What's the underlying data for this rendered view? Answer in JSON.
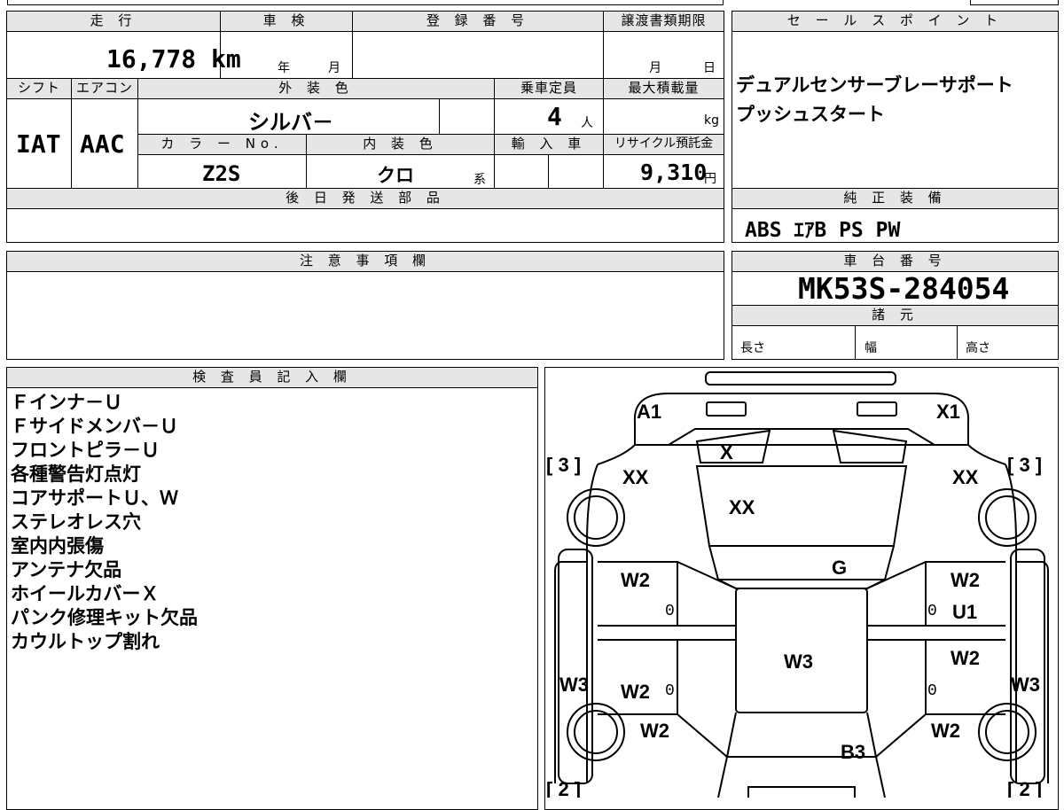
{
  "header": {
    "mileage_label": "走 行",
    "mileage_value": "16,778 km",
    "shaken_label": "車 検",
    "shaken_year_label": "年",
    "shaken_month_label": "月",
    "registration_label": "登 録 番 号",
    "transfer_label": "譲渡書類期限",
    "transfer_month_label": "月",
    "transfer_day_label": "日",
    "shift_label": "シフト",
    "shift_value": "IAT",
    "ac_label": "エアコン",
    "ac_value": "AAC",
    "exterior_color_label": "外 装 色",
    "exterior_color_value": "シルバ－",
    "capacity_label": "乗車定員",
    "capacity_value": "4",
    "capacity_unit": "人",
    "max_load_label": "最大積載量",
    "max_load_unit": "kg",
    "color_no_label": "カ ラ ー No.",
    "color_no_value": "Z2S",
    "interior_color_label": "内 装 色",
    "interior_color_value": "クロ",
    "interior_suffix": "系",
    "import_label": "輸 入 車",
    "recycle_label": "リサイクル預託金",
    "recycle_value": "9,310",
    "recycle_unit": "円",
    "later_parts_label": "後 日 発 送 部 品"
  },
  "sales_point": {
    "label": "セ ー ル ス ポ イ ン ト",
    "lines": [
      "デュアルセンサーブレーサポート",
      "プッシュスタート"
    ]
  },
  "equipment": {
    "label": "純 正 装 備",
    "value": "ABS ｴｱB PS PW"
  },
  "notes": {
    "label": "注 意 事 項 欄"
  },
  "chassis": {
    "label": "車 台 番 号",
    "value": "MK53S-284054",
    "spec_label": "諸 元",
    "length_label": "長さ",
    "width_label": "幅",
    "height_label": "高さ"
  },
  "inspector": {
    "label": "検 査 員 記 入 欄",
    "lines": [
      "Ｆインナ－Ｕ",
      "Ｆサイドメンバ－Ｕ",
      "フロントピラ－Ｕ",
      "各種警告灯点灯",
      "コアサポートＵ、Ｗ",
      "ステレオレス穴",
      "室内内張傷",
      "アンテナ欠品",
      "ホイールカバーＸ",
      "パンク修理キット欠品",
      "カウルトップ割れ"
    ]
  },
  "diagram": {
    "marks": {
      "a1": "A1",
      "x1": "X1",
      "x": "X",
      "xx_left": "XX",
      "xx_center": "XX",
      "xx_right": "XX",
      "g": "G",
      "w2_lf": "W2",
      "w2_rf": "W2",
      "u1": "U1",
      "w3_center": "W3",
      "w2_lr": "W2",
      "w2_rr": "W2",
      "w3_left": "W3",
      "w3_right": "W3",
      "w2_lw": "W2",
      "w2_rw": "W2",
      "b3": "B3",
      "zero": "0"
    },
    "tire_fl": "[ 3 ]",
    "tire_fr": "[ 3 ]",
    "tire_rl": "[ 2 ]",
    "tire_rr": "[ 2 ]"
  }
}
